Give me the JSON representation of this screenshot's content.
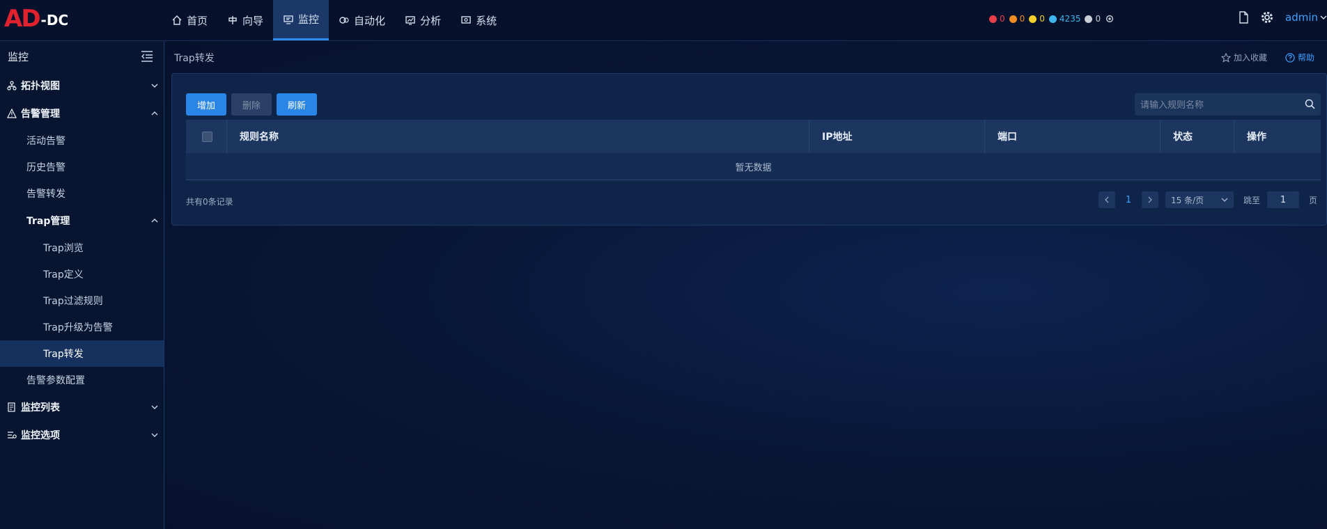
{
  "logo": {
    "main": "AD",
    "suffix": "-DC"
  },
  "nav": [
    {
      "label": "首页",
      "icon": "home-icon"
    },
    {
      "label": "向导",
      "icon": "guide-icon"
    },
    {
      "label": "监控",
      "icon": "monitor-icon",
      "active": true
    },
    {
      "label": "自动化",
      "icon": "automation-icon"
    },
    {
      "label": "分析",
      "icon": "analysis-icon"
    },
    {
      "label": "系统",
      "icon": "system-icon"
    }
  ],
  "alarms": [
    {
      "count": "0",
      "color": "#e8404b"
    },
    {
      "count": "0",
      "color": "#f08a24"
    },
    {
      "count": "0",
      "color": "#f2cf2a"
    },
    {
      "count": "4235",
      "color": "#3fb6ee"
    },
    {
      "count": "0",
      "color": "#c8cdd6"
    }
  ],
  "user": {
    "name": "admin"
  },
  "sidebar": {
    "title": "监控",
    "groups": {
      "topology": "拓扑视图",
      "alarm_mgmt": "告警管理",
      "monitor_list": "监控列表",
      "monitor_options": "监控选项"
    },
    "alarm_items": {
      "active": "活动告警",
      "history": "历史告警",
      "forward": "告警转发",
      "params": "告警参数配置"
    },
    "trap": {
      "title": "Trap管理",
      "items": [
        "Trap浏览",
        "Trap定义",
        "Trap过滤规则",
        "Trap升级为告警",
        "Trap转发"
      ]
    }
  },
  "breadcrumb": "Trap转发",
  "actions": {
    "favorite": "加入收藏",
    "help": "帮助"
  },
  "toolbar": {
    "add": "增加",
    "delete": "删除",
    "refresh": "刷新"
  },
  "search": {
    "placeholder": "请输入规则名称"
  },
  "table": {
    "columns": [
      "规则名称",
      "IP地址",
      "端口",
      "状态",
      "操作"
    ],
    "empty": "暂无数据"
  },
  "footer": {
    "total": "共有0条记录",
    "page": "1",
    "page_size": "15 条/页",
    "jump_label": "跳至",
    "jump_value": "1",
    "page_suffix": "页"
  },
  "colors": {
    "accent": "#2a86e6",
    "link": "#3ea0ff",
    "logo_red": "#e0212e"
  }
}
